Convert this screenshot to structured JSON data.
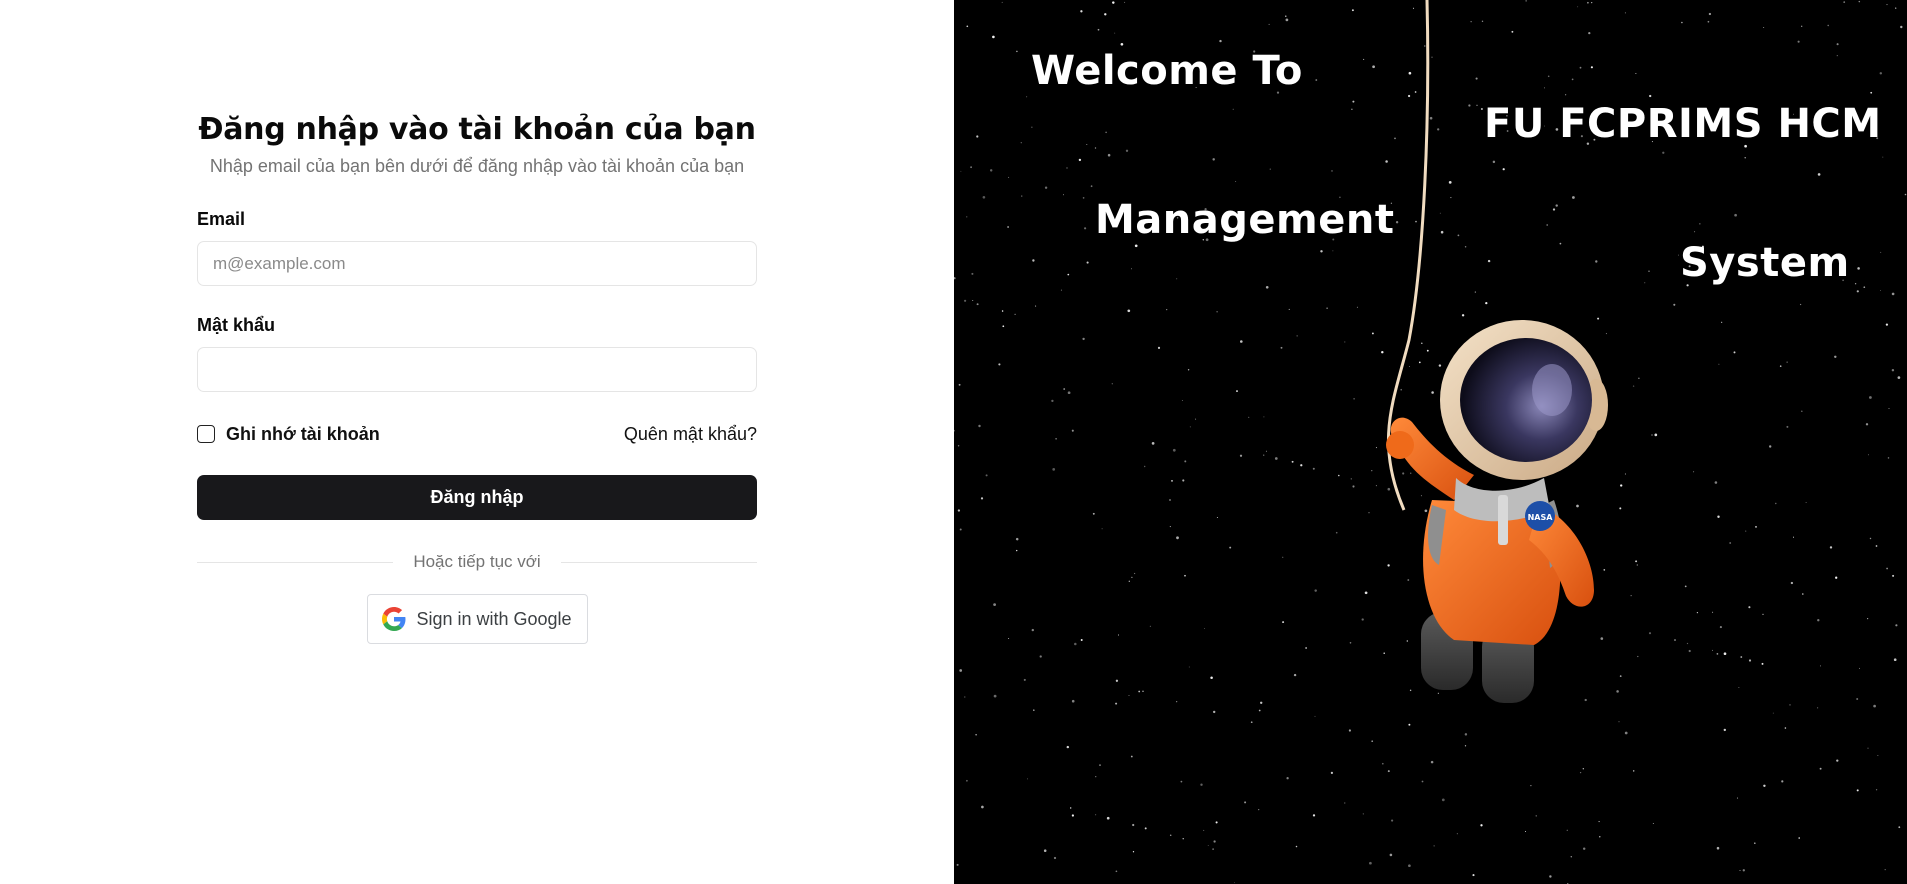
{
  "login": {
    "title": "Đăng nhập vào tài khoản của bạn",
    "subtitle": "Nhập email của bạn bên dưới để đăng nhập vào tài khoản của bạn",
    "email_label": "Email",
    "email_placeholder": "m@example.com",
    "email_value": "",
    "password_label": "Mật khẩu",
    "password_value": "",
    "remember_label": "Ghi nhớ tài khoản",
    "forgot_link": "Quên mật khẩu?",
    "submit_label": "Đăng nhập",
    "divider_text": "Hoặc tiếp tục với",
    "google_label": "Sign in with Google",
    "google_icon": "google-g-icon"
  },
  "hero": {
    "welcome": "Welcome To",
    "org": "FU FCPRIMS HCM",
    "management": "Management",
    "system": "System",
    "badge": "NASA"
  },
  "colors": {
    "primary_button": "#18181b",
    "hero_background": "#000000",
    "suit_orange": "#f26a1b"
  }
}
